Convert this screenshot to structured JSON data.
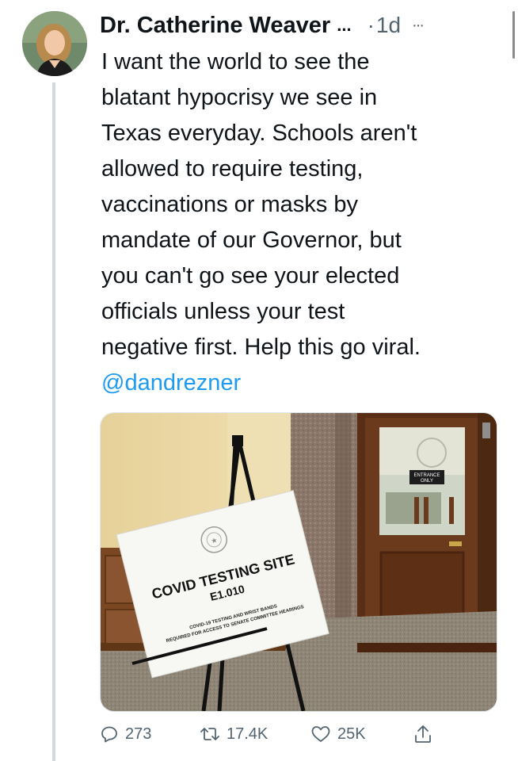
{
  "tweet": {
    "author_name": "Dr. Catherine Weaver",
    "name_truncation": "...",
    "separator": "·",
    "time": "1d",
    "more": "···",
    "text_lines": [
      "I want the world to see the",
      "blatant hypocrisy we see in",
      "Texas everyday. Schools aren't",
      "allowed to require testing,",
      "vaccinations or masks by",
      "mandate of our Governor, but",
      "you can't go see your elected",
      "officials unless your test",
      "negative first. Help this go viral."
    ],
    "mention": "@dandrezner"
  },
  "media": {
    "sign": {
      "title": "COVID TESTING SITE",
      "room": "E1.010",
      "line1": "COVID-19 TESTING AND WRIST BANDS",
      "line2": "REQUIRED FOR ACCESS TO SENATE COMMITTEE HEARINGS"
    },
    "door_sign": {
      "line1": "ENTRANCE",
      "line2": "ONLY"
    }
  },
  "actions": {
    "replies": "273",
    "retweets": "17.4K",
    "likes": "25K"
  },
  "icons": {
    "reply": "reply-icon",
    "retweet": "retweet-icon",
    "like": "heart-icon",
    "share": "share-icon",
    "more": "more-icon"
  },
  "colors": {
    "mention": "#1d9bf0",
    "secondary": "#536471",
    "thread_line": "#cfd9de"
  }
}
